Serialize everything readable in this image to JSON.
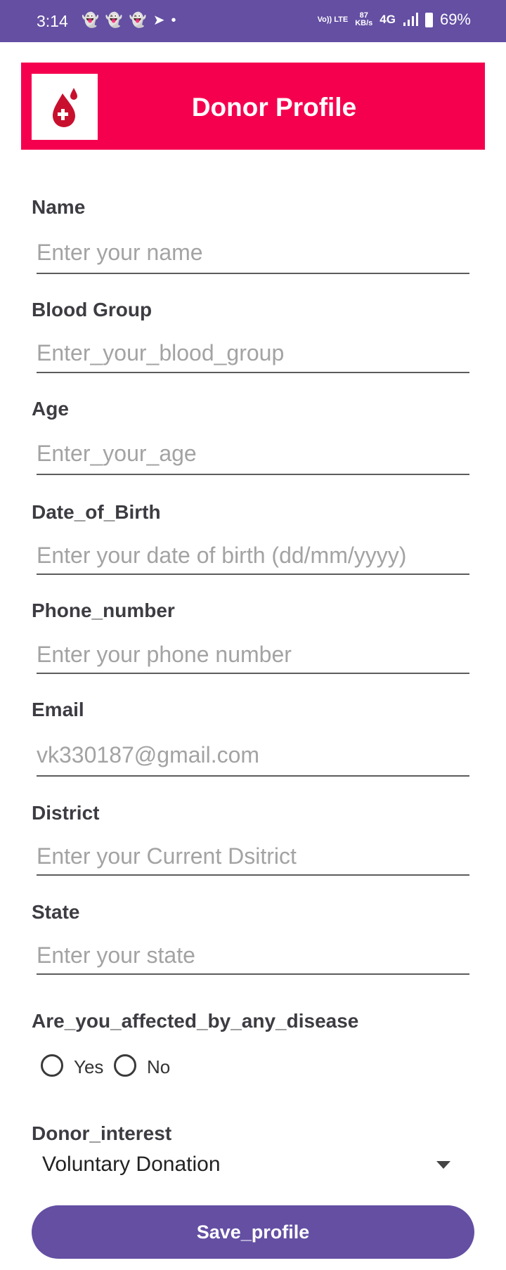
{
  "status_bar": {
    "time": "3:14",
    "volte": "Vo)) LTE",
    "speed_value": "87",
    "speed_unit": "KB/s",
    "network": "4G",
    "battery": "69%",
    "notification_icons": [
      "snapchat-icon",
      "snapchat-icon",
      "snapchat-icon",
      "telegram-icon",
      "dot-icon"
    ]
  },
  "header": {
    "title": "Donor Profile",
    "logo_icon": "blood-drop-icon",
    "background_color": "#f5004f"
  },
  "fields": {
    "name": {
      "label": "Name",
      "placeholder": "Enter your name"
    },
    "blood_group": {
      "label": "Blood Group",
      "placeholder": "Enter_your_blood_group"
    },
    "age": {
      "label": "Age",
      "placeholder": "Enter_your_age"
    },
    "dob": {
      "label": "Date_of_Birth",
      "placeholder": "Enter your date of birth (dd/mm/yyyy)"
    },
    "phone": {
      "label": "Phone_number",
      "placeholder": "Enter your phone number"
    },
    "email": {
      "label": "Email",
      "placeholder": "vk330187@gmail.com"
    },
    "district": {
      "label": "District",
      "placeholder": "Enter your Current Dsitrict"
    },
    "state": {
      "label": "State",
      "placeholder": "Enter your state"
    }
  },
  "disease": {
    "label": "Are_you_affected_by_any_disease",
    "options": [
      "Yes",
      "No"
    ]
  },
  "donor_interest": {
    "label": "Donor_interest",
    "selected": "Voluntary Donation"
  },
  "save_button": {
    "label": "Save_profile"
  },
  "colors": {
    "accent": "#644fa3",
    "header": "#f5004f"
  }
}
